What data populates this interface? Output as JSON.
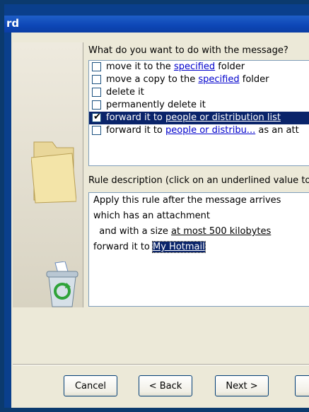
{
  "window": {
    "title_fragment": "rd"
  },
  "question": {
    "label": "What do you want to do with the message?",
    "accesskey": "W"
  },
  "actions": [
    {
      "pre": "move it to the ",
      "link": "specified",
      "post": " folder",
      "checked": false,
      "selected": false
    },
    {
      "pre": "move a copy to the ",
      "link": "specified",
      "post": " folder",
      "checked": false,
      "selected": false
    },
    {
      "pre": "delete it",
      "link": "",
      "post": "",
      "checked": false,
      "selected": false
    },
    {
      "pre": "permanently delete it",
      "link": "",
      "post": "",
      "checked": false,
      "selected": false
    },
    {
      "pre": "forward it to ",
      "link": "people or distribution list",
      "post": "",
      "checked": true,
      "selected": true
    },
    {
      "pre": "forward it to ",
      "link": "people or distribu...",
      "post": " as an att",
      "checked": false,
      "selected": false
    }
  ],
  "rule_description": {
    "label": "Rule description (click on an underlined value to",
    "lines": [
      {
        "text": "Apply this rule after the message arrives"
      },
      {
        "text": "which has an attachment"
      },
      {
        "pre": "  and with a size ",
        "link": "at most 500 kilobytes"
      },
      {
        "pre": "forward it to ",
        "link": "My Hotmail"
      }
    ]
  },
  "buttons": {
    "cancel": "Cancel",
    "back": "< Back",
    "next": "Next >"
  },
  "colors": {
    "selection": "#0a246a",
    "titlebar": "#0d46b6",
    "dialog_bg": "#ece9d8"
  }
}
